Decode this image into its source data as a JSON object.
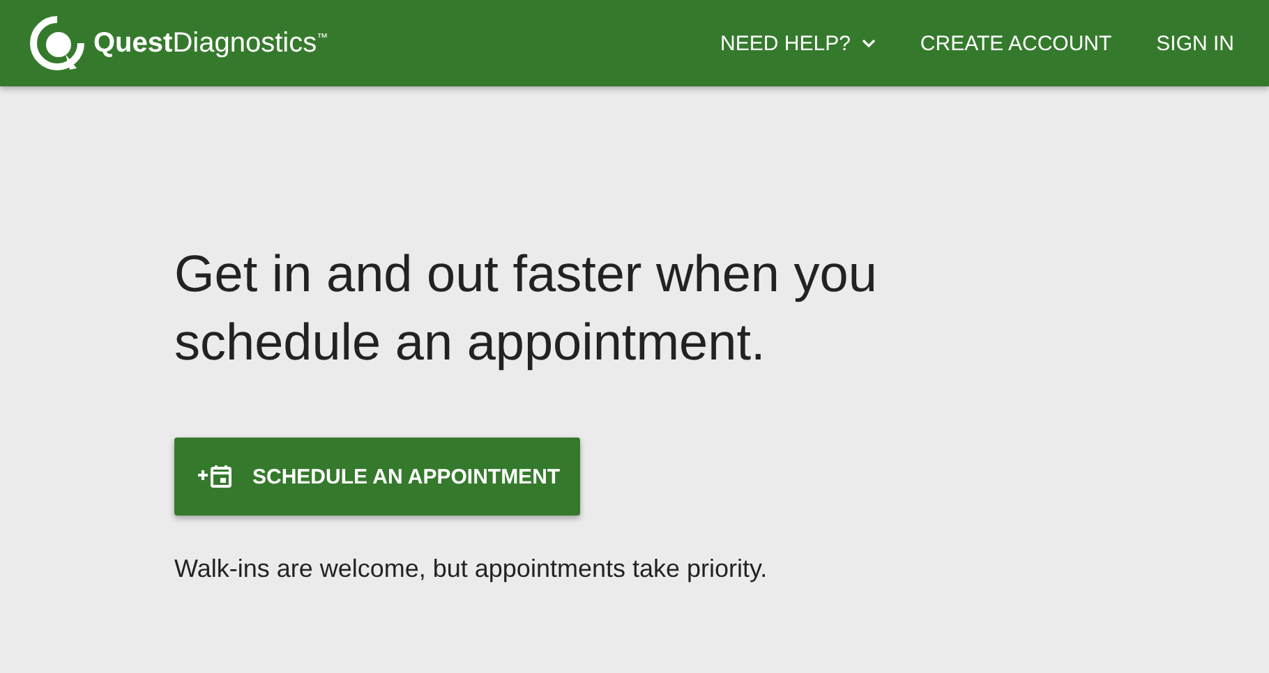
{
  "header": {
    "logo": "**Quest**Diagnostics$^{™}$",
    "nav": [
      {
        "label": "NEED HELP?",
        "kind": "dropdown"
      },
      {
        "label": "CREATE ACCOUNT",
        "kind": "link"
      },
      {
        "label": "SIGN IN",
        "kind": "link"
      }
    ]
  },
  "hero": {
    "heading": "Get in and out faster when you schedule an appointment.",
    "button": "SCHEDULE AN APPOINTMENT",
    "note": "Walk-ins are welcome, but appointments take priority."
  }
}
